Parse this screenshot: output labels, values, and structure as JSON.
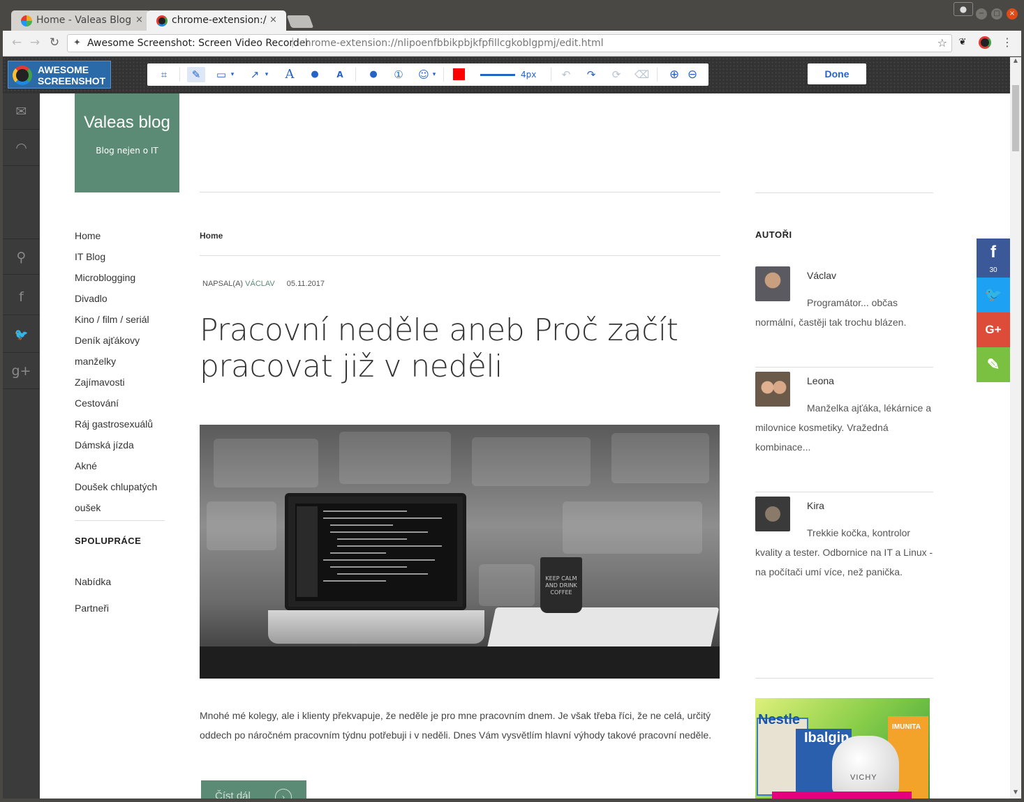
{
  "browser": {
    "tabs": [
      {
        "title": "Home - Valeas Blog",
        "close": "×"
      },
      {
        "title": "chrome-extension://nlipoenfbbikpbjkfpfillcgkoblgpmj/edit.html",
        "close": "×"
      }
    ],
    "profile_icon": "person-icon",
    "window_controls": [
      "−",
      "□",
      "×"
    ],
    "nav": {
      "back": "←",
      "forward": "→",
      "reload": "↻"
    },
    "omnibox": {
      "site_label": "Awesome Screenshot: Screen Video Recorder",
      "separator": "|",
      "url": "chrome-extension://nlipoenfbbikpbjkfpfillcgkoblgpmj/edit.html",
      "star": "☆"
    },
    "menu": "⋮"
  },
  "awesome_screenshot": {
    "logo_line1": "AWESOME",
    "logo_line2": "SCREENSHOT",
    "tools": {
      "crop": "⌗",
      "pen": "✎",
      "rect": "▭",
      "caret": "▾",
      "arrow": "↗",
      "text": "A",
      "blur": "●",
      "highlight": "A",
      "comment": "●",
      "number": "①",
      "emoji": "☺",
      "undo": "↶",
      "redo": "↷",
      "reset": "⟳",
      "clear": "⌫",
      "zoom_in": "⊕",
      "zoom_out": "⊖"
    },
    "stroke_width": "4px",
    "color": "#ff0000",
    "done": "Done"
  },
  "left_social": [
    "✉",
    "◠",
    "⚲",
    "f",
    "🐦",
    "g+"
  ],
  "blog": {
    "title": "Valeas blog",
    "subtitle": "Blog nejen o IT",
    "menu": [
      "Home",
      "IT Blog",
      "Microblogging",
      "Divadlo",
      "Kino / film / seriál",
      "Deník ajťákovy",
      "manželky",
      "Zajímavosti",
      "Cestování",
      "Ráj gastrosexuálů",
      "Dámská jízda",
      "Akné",
      "Doušek chlupatých",
      "oušek"
    ],
    "cooperation_head": "SPOLUPRÁCE",
    "cooperation": [
      "Nabídka",
      "Partneři"
    ]
  },
  "post": {
    "breadcrumb": "Home",
    "author_label": "NAPSAL(A)",
    "author": "VÁCLAV",
    "date": "05.11.2017",
    "title": "Pracovní neděle aneb Proč začít pracovat již v neděli",
    "mug_text": "KEEP CALM AND DRINK COFFEE",
    "excerpt": "Mnohé mé kolegy, ale i klienty překvapuje, že neděle je pro mne pracovním dnem. Je však třeba říci, že ne celá, určitý oddech po náročném pracovním týdnu potřebuji i v neděli. Dnes Vám vysvětlím hlavní výhody takové pracovní neděle.",
    "read_more": "Číst dál",
    "read_more_arrow": "›"
  },
  "sidebar": {
    "authors_head": "AUTOŘI",
    "authors": [
      {
        "name": "Václav",
        "bio": "Programátor... občas normální, častěji tak trochu blázen."
      },
      {
        "name": "Leona",
        "bio": "Manželka ajťáka, lékárnice a milovnice kosmetiky. Vražedná kombinace..."
      },
      {
        "name": "Kira",
        "bio": "Trekkie kočka, kontrolor kvality a tester. Odbornice na IT a Linux - na počítači umí více, než panička."
      }
    ],
    "ad": {
      "brand1": "Nestle",
      "brand2": "Ibalgin",
      "brand3": "VICHY",
      "brand4": "IMUNITA"
    }
  },
  "share": {
    "facebook": "f",
    "facebook_count": "30",
    "twitter": "🐦",
    "google": "G+",
    "evernote": "✎"
  }
}
